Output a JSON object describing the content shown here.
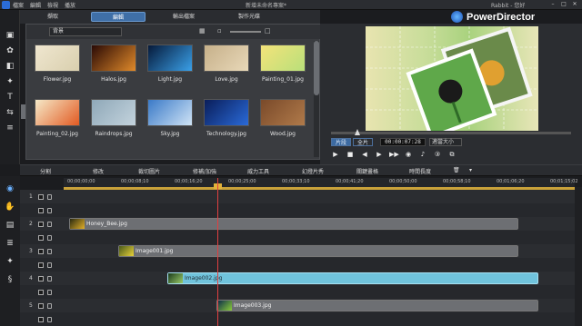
{
  "app": {
    "title": "新增未命名專案*",
    "user": "Rabbit - 您好",
    "brand": "PowerDirector"
  },
  "menu": [
    "檔案",
    "編輯",
    "檢視",
    "播放"
  ],
  "tabs": [
    {
      "label": "擷取",
      "active": false
    },
    {
      "label": "編輯",
      "active": true
    },
    {
      "label": "輸出檔案",
      "active": false
    },
    {
      "label": "製作光碟",
      "active": false
    }
  ],
  "library": {
    "category": "背景",
    "items": [
      {
        "label": "Flower.jpg",
        "colors": [
          "#efe6cf",
          "#d9cfae"
        ]
      },
      {
        "label": "Halos.jpg",
        "colors": [
          "#2a0a05",
          "#e08a2a"
        ]
      },
      {
        "label": "Light.jpg",
        "colors": [
          "#061a3a",
          "#3aa0e8"
        ]
      },
      {
        "label": "Love.jpg",
        "colors": [
          "#c6b08a",
          "#e8d8b8"
        ]
      },
      {
        "label": "Painting_01.jpg",
        "colors": [
          "#f3e27a",
          "#b9e07a"
        ]
      },
      {
        "label": "Painting_02.jpg",
        "colors": [
          "#f5e9c8",
          "#e25a22"
        ]
      },
      {
        "label": "Raindrops.jpg",
        "colors": [
          "#8fa8b8",
          "#c3d3dd"
        ]
      },
      {
        "label": "Sky.jpg",
        "colors": [
          "#3a7ac8",
          "#cfe3f5"
        ]
      },
      {
        "label": "Technology.jpg",
        "colors": [
          "#0a1e5a",
          "#2a6ad8"
        ]
      },
      {
        "label": "Wood.jpg",
        "colors": [
          "#7a4a2a",
          "#b07a4a"
        ]
      }
    ]
  },
  "preview": {
    "mode_clip": "片段",
    "mode_movie": "全片",
    "timecode": "00:00:07:28",
    "fit": "適當大小"
  },
  "edit_tools": [
    "分割",
    "修改",
    "裁切圖片",
    "修補/加強",
    "威力工具",
    "幻燈片秀",
    "關鍵畫格",
    "時間長度"
  ],
  "ruler": [
    "00;00;00;00",
    "00;00;08;10",
    "00;00;16;20",
    "00;00;25;00",
    "00;00;33;10",
    "00;00;41;20",
    "00;00;50;00",
    "00;00;58;10",
    "00;01;06;20",
    "00;01;15;02"
  ],
  "tracks": [
    {
      "num": "1",
      "clip": null
    },
    {
      "num": "",
      "clip": null
    },
    {
      "num": "2",
      "clip": {
        "label": "Honey_Bee.jpg",
        "colors": [
          "#2a2a10",
          "#e2b02a"
        ]
      }
    },
    {
      "num": "",
      "clip": null
    },
    {
      "num": "3",
      "clip": {
        "label": "Image001.jpg",
        "colors": [
          "#4a5a1a",
          "#e8d23a"
        ]
      }
    },
    {
      "num": "",
      "clip": null
    },
    {
      "num": "4",
      "clip": {
        "label": "Image002.jpg",
        "colors": [
          "#1a3a1a",
          "#9acc6a"
        ],
        "selected": true
      }
    },
    {
      "num": "",
      "clip": null
    },
    {
      "num": "5",
      "clip": {
        "label": "Image003.jpg",
        "colors": [
          "#0a2a4a",
          "#8acc3a"
        ]
      }
    },
    {
      "num": "",
      "clip": null
    }
  ]
}
